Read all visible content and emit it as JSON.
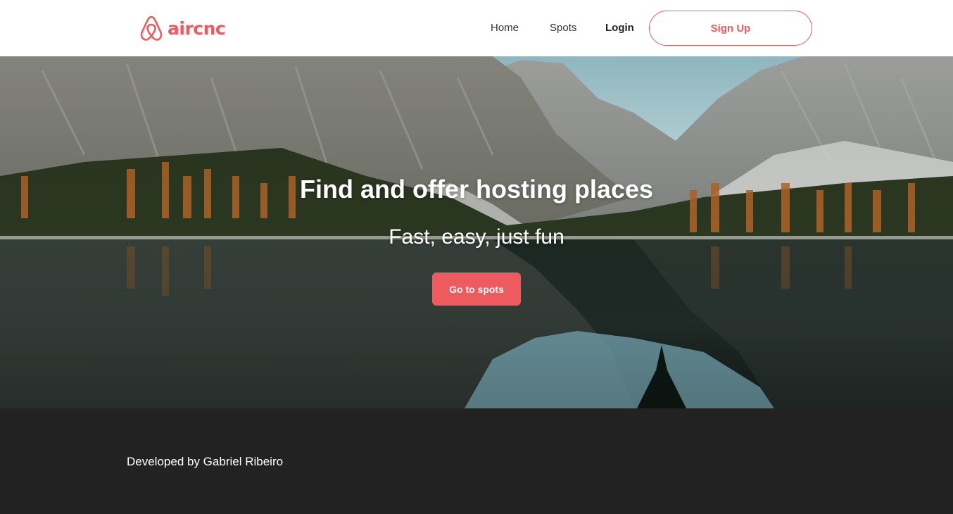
{
  "brand": {
    "name": "aircnc",
    "color": "#ee5b5f"
  },
  "nav": {
    "home": "Home",
    "spots": "Spots",
    "login": "Login",
    "signup": "Sign Up"
  },
  "hero": {
    "title": "Find and offer hosting places",
    "subtitle": "Fast, easy, just fun",
    "cta": "Go to spots"
  },
  "footer": {
    "credit": "Developed by Gabriel Ribeiro",
    "background": "#222222"
  }
}
